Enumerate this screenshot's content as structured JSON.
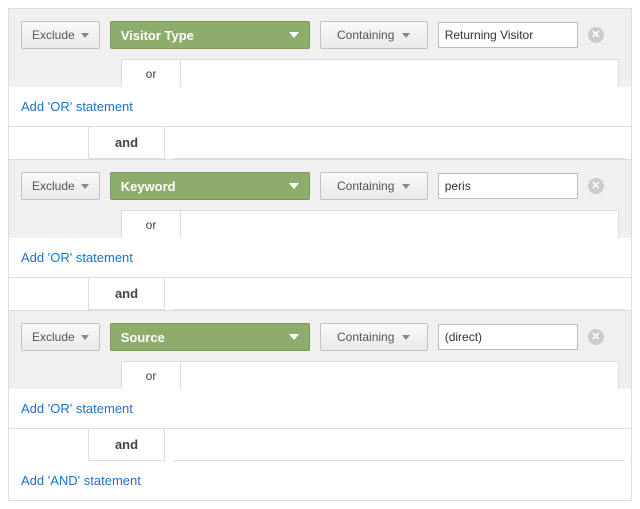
{
  "labels": {
    "exclude": "Exclude",
    "containing": "Containing",
    "or": "or",
    "and": "and",
    "add_or": "Add 'OR' statement",
    "add_and": "Add 'AND' statement"
  },
  "conditions": [
    {
      "dimension": "Visitor Type",
      "match": "Containing",
      "value": "Returning Visitor"
    },
    {
      "dimension": "Keyword",
      "match": "Containing",
      "value": "peris"
    },
    {
      "dimension": "Source",
      "match": "Containing",
      "value": "(direct)"
    }
  ]
}
